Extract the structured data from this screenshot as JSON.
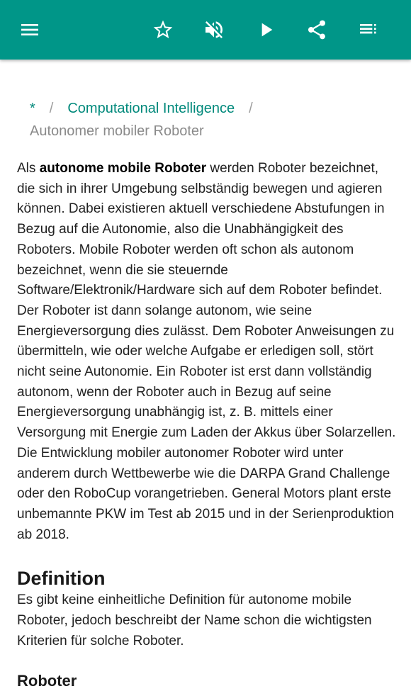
{
  "toolbar": {
    "menu_icon": "menu-icon",
    "favorite_icon": "star-outline-icon",
    "mute_icon": "volume-off-icon",
    "play_icon": "play-icon",
    "share_icon": "share-icon",
    "list_icon": "playlist-icon",
    "color": "#009688"
  },
  "breadcrumb": {
    "home": "*",
    "separator": "/",
    "category": "Computational Intelligence",
    "current": "Autonomer mobiler Roboter",
    "link_color": "#00897b"
  },
  "article": {
    "intro_prefix": "Als ",
    "intro_bold": "autonome mobile Roboter",
    "intro_rest": " werden Roboter bezeichnet, die sich in ihrer Umgebung selbständig bewegen und agieren können. Dabei existieren aktuell verschiedene Abstufungen in Bezug auf die Autonomie, also die Unabhängigkeit des Roboters. Mobile Roboter werden oft schon als autonom bezeichnet, wenn die sie steuernde Software/Elektronik/Hardware sich auf dem Roboter befindet. Der Roboter ist dann solange autonom, wie seine Energieversorgung dies zulässt. Dem Roboter Anweisungen zu übermitteln, wie oder welche Aufgabe er erledigen soll, stört nicht seine Autonomie. Ein Roboter ist erst dann vollständig autonom, wenn der Roboter auch in Bezug auf seine Energieversorgung unabhängig ist, z. B. mittels einer Versorgung mit Energie zum Laden der Akkus über Solarzellen. Die Entwicklung mobiler autonomer Roboter wird unter anderem durch Wettbewerbe wie die DARPA Grand Challenge oder den RoboCup vorangetrieben. General Motors plant erste unbemannte PKW im Test ab 2015 und in der Serienproduktion ab 2018.",
    "section_heading": "Definition",
    "section_text": "Es gibt keine einheitliche Definition für autonome mobile Roboter, jedoch beschreibt der Name schon die wichtigsten Kriterien für solche Roboter.",
    "subheading": "Roboter"
  }
}
